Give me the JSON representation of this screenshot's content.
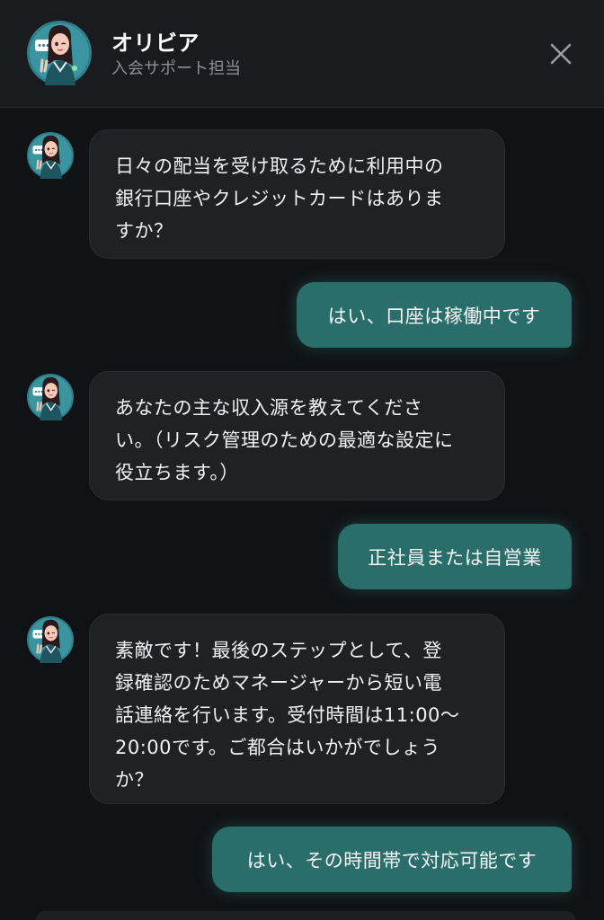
{
  "header": {
    "name": "オリビア",
    "subtitle": "入会サポート担当"
  },
  "messages": [
    {
      "sender": "bot",
      "text": "日々の配当を受け取るために利用中の\n銀行口座やクレジットカードはありま\nすか？"
    },
    {
      "sender": "user",
      "text": "はい、口座は稼働中です"
    },
    {
      "sender": "bot",
      "text": "あなたの主な収入源を教えてくださ\nい。（リスク管理のための最適な設定に\n役立ちます。）"
    },
    {
      "sender": "user",
      "text": "正社員または自営業"
    },
    {
      "sender": "bot",
      "text": "素敵です！最後のステップとして、登\n録確認のためマネージャーから短い電\n話連絡を行います。受付時間は11:00〜\n20:00です。ご都合はいかがでしょう\nか？"
    },
    {
      "sender": "user",
      "text": "はい、その時間帯で対応可能です"
    }
  ],
  "colors": {
    "background": "#111215",
    "header": "#1a1b1f",
    "bot_bubble": "#202125",
    "user_bubble": "#2a6e6b",
    "avatar_bg": "#2e7f8a"
  },
  "icons": {
    "close": "close-icon",
    "avatar": "assistant-avatar"
  }
}
